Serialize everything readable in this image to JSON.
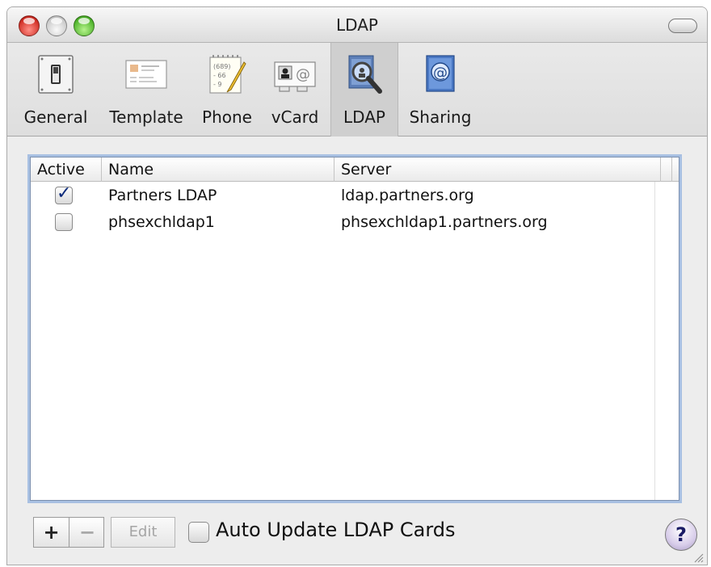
{
  "window": {
    "title": "LDAP"
  },
  "toolbar": {
    "items": [
      {
        "label": "General",
        "icon": "light-switch-icon"
      },
      {
        "label": "Template",
        "icon": "card-template-icon"
      },
      {
        "label": "Phone",
        "icon": "phone-notepad-icon"
      },
      {
        "label": "vCard",
        "icon": "vcard-icon"
      },
      {
        "label": "LDAP",
        "icon": "ldap-magnifier-icon",
        "selected": true
      },
      {
        "label": "Sharing",
        "icon": "sharing-at-book-icon"
      }
    ]
  },
  "table": {
    "columns": [
      "Active",
      "Name",
      "Server"
    ],
    "rows": [
      {
        "active": true,
        "name": "Partners LDAP",
        "server": "ldap.partners.org"
      },
      {
        "active": false,
        "name": "phsexchldap1",
        "server": "phsexchldap1.partners.org"
      }
    ]
  },
  "controls": {
    "add": "+",
    "remove": "−",
    "edit": "Edit",
    "auto_update_label": "Auto Update LDAP Cards",
    "auto_update_checked": false,
    "help": "?"
  },
  "colors": {
    "selection_ring": "#a8c0e2",
    "check_tick": "#0c2a7a"
  }
}
